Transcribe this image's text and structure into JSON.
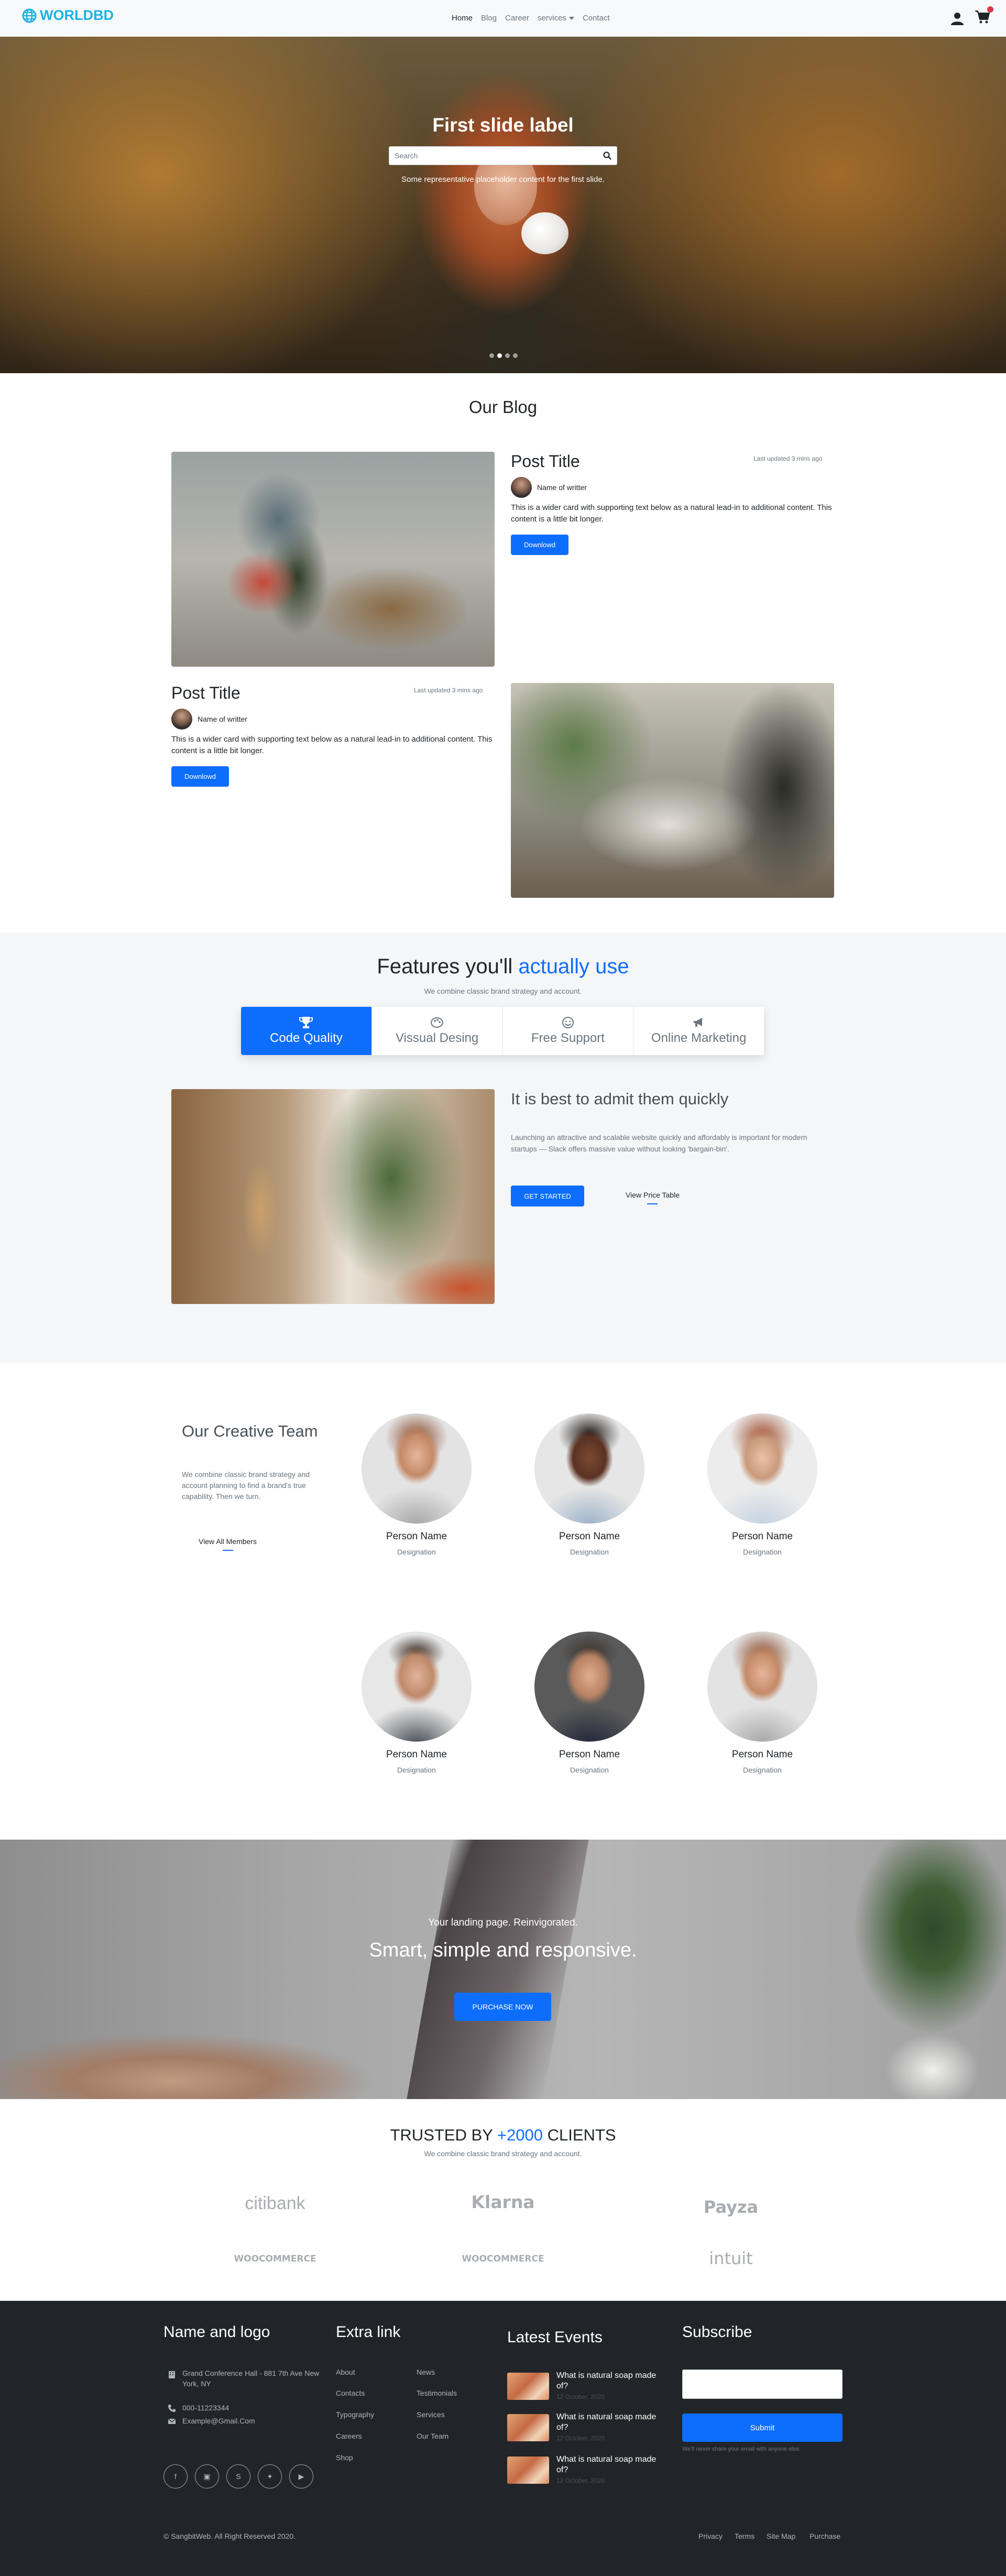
{
  "nav": {
    "brand": "WORLDBD",
    "items": [
      "Home",
      "Blog",
      "Career",
      "services",
      "Contact"
    ]
  },
  "hero": {
    "title": "First slide label",
    "search_placeholder": "Search",
    "subtitle": "Some representative placeholder content for the first slide."
  },
  "blog": {
    "title": "Our Blog",
    "posts": [
      {
        "title": "Post Title",
        "updated": "Last updated 3 mins ago",
        "writer": "Name of writter",
        "text": "This is a wider card with supporting text below as a natural lead-in to additional content. This content is a little bit longer.",
        "button": "Downlowd"
      },
      {
        "title": "Post Title",
        "updated": "Last updated 3 mins ago",
        "writer": "Name of writter",
        "text": "This is a wider card with supporting text below as a natural lead-in to additional content. This content is a little bit longer.",
        "button": "Downlowd"
      }
    ]
  },
  "features": {
    "heading_pre": "Features you'll ",
    "heading_hl": "actually use",
    "sub": "We combine classic brand strategy and account.",
    "tabs": [
      "Code Quality",
      "Vissual Desing",
      "Free Support",
      "Online Marketing"
    ],
    "h3": "It is best to admit them quickly",
    "p": "Launching an attractive and scalable website quickly and affordably is important for modern startups — Slack offers massive value without looking 'bargain-bin'.",
    "cta": "GET STARTED",
    "link": "View Price Table"
  },
  "team": {
    "title": "Our Creative Team",
    "desc": "We combine classic brand strategy and account planning to find a brand's true capability. Then we turn.",
    "link": "View All Members",
    "members": [
      {
        "name": "Person Name",
        "designation": "Designation"
      },
      {
        "name": "Person Name",
        "designation": "Designation"
      },
      {
        "name": "Person Name",
        "designation": "Designation"
      },
      {
        "name": "Person Name",
        "designation": "Designation"
      },
      {
        "name": "Person Name",
        "designation": "Designation"
      },
      {
        "name": "Person Name",
        "designation": "Designation"
      }
    ]
  },
  "landing": {
    "tag": "Your landing page. Reinvigorated.",
    "heading": "Smart, simple and responsive.",
    "button": "PURCHASE NOW"
  },
  "clients": {
    "pre": "TRUSTED BY ",
    "hl": "+2000",
    "post": " CLIENTS",
    "sub": "We combine classic brand strategy and account.",
    "logos": [
      "citibank",
      "Klarna",
      "Payza",
      "WOOCOMMERCE",
      "WOOCOMMERCE",
      "intuit"
    ]
  },
  "footer": {
    "col1_title": "Name and logo",
    "address": "Grand Conference Hall - 881 7th Ave New York, NY",
    "phone": "000-11223344",
    "email": "Example@Gmail.Com",
    "col2_title": "Extra link",
    "links_a": [
      "About",
      "Contacts",
      "Typography",
      "Careers",
      "Shop"
    ],
    "links_b": [
      "News",
      "Testimonials",
      "Services",
      "Our Team"
    ],
    "col3_title": "Latest Events",
    "events": [
      {
        "title": "What is natural soap made of?",
        "date": "12 October, 2020"
      },
      {
        "title": "What is natural soap made of?",
        "date": "12 October, 2020"
      },
      {
        "title": "What is natural soap made of?",
        "date": "12 October, 2020"
      }
    ],
    "col4_title": "Subscribe",
    "submit": "Submit",
    "note": "We'll never share your email with anyone else.",
    "copyright": "© SangbitWeb. All Right Reserved 2020.",
    "bottom_links": [
      "Privacy",
      "Terms",
      "Site Map",
      "Purchase"
    ]
  },
  "colors": {
    "primary": "#0d6efd",
    "brand": "#17b3e6",
    "footer_bg": "#212529"
  }
}
